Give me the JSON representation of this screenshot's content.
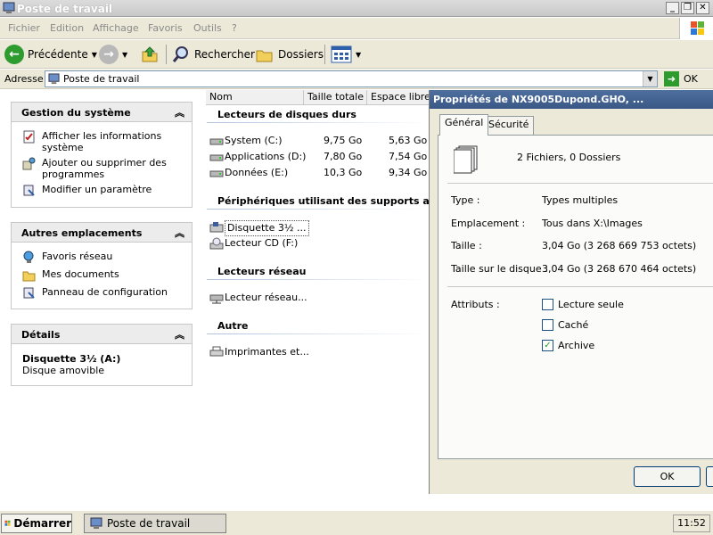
{
  "window": {
    "title": "Poste de travail",
    "controls": {
      "minimize": "_",
      "maximize": "❐",
      "close": "✕"
    }
  },
  "menu": {
    "items": [
      "Fichier",
      "Edition",
      "Affichage",
      "Favoris",
      "Outils",
      "?"
    ]
  },
  "toolbar": {
    "back_label": "Précédente",
    "search_label": "Rechercher",
    "folders_label": "Dossiers"
  },
  "address": {
    "label": "Adresse",
    "value": "Poste de travail",
    "go_label": "OK"
  },
  "tasks": {
    "system": {
      "title": "Gestion du système",
      "items": [
        {
          "line1": "Afficher les informations",
          "line2": "système"
        },
        {
          "line1": "Ajouter ou supprimer des",
          "line2": "programmes"
        },
        {
          "line1": "Modifier un paramètre",
          "line2": ""
        }
      ]
    },
    "other": {
      "title": "Autres emplacements",
      "items": [
        "Favoris réseau",
        "Mes documents",
        "Panneau de configuration"
      ]
    },
    "details": {
      "title": "Détails",
      "name": "Disquette 3½ (A:)",
      "type": "Disque amovible"
    },
    "collapse_glyph": "«"
  },
  "columns": [
    "Nom",
    "Taille totale",
    "Espace libre"
  ],
  "groups": {
    "hard_drives": {
      "title": "Lecteurs de disques durs",
      "rows": [
        {
          "name": "System (C:)",
          "total": "9,75 Go",
          "free": "5,63 Go"
        },
        {
          "name": "Applications (D:)",
          "total": "7,80 Go",
          "free": "7,54 Go"
        },
        {
          "name": "Données (E:)",
          "total": "10,3 Go",
          "free": "9,34 Go"
        }
      ]
    },
    "removable": {
      "title": "Périphériques utilisant des supports amovi",
      "rows": [
        {
          "name": "Disquette 3½ ..."
        },
        {
          "name": "Lecteur CD (F:)"
        }
      ]
    },
    "network": {
      "title": "Lecteurs réseau",
      "rows": [
        {
          "name": "Lecteur réseau..."
        }
      ]
    },
    "other": {
      "title": "Autre",
      "rows": [
        {
          "name": "Imprimantes et..."
        }
      ]
    }
  },
  "dialog": {
    "title": "Propriétés de NX9005Dupond.GHO, ...",
    "tabs": [
      "Général",
      "Sécurité"
    ],
    "summary": "2 Fichiers, 0 Dossiers",
    "fields": [
      {
        "label": "Type :",
        "value": "Types multiples"
      },
      {
        "label": "Emplacement :",
        "value": "Tous dans X:\\Images"
      },
      {
        "label": "Taille :",
        "value": "3,04 Go (3 268 669 753 octets)"
      },
      {
        "label": "Taille sur le disque :",
        "value": "3,04 Go (3 268 670 464 octets)"
      }
    ],
    "attributes_label": "Attributs :",
    "attributes": [
      {
        "label": "Lecture seule",
        "checked": false
      },
      {
        "label": "Caché",
        "checked": false
      },
      {
        "label": "Archive",
        "checked": true
      }
    ],
    "check_glyph": "✓",
    "ok_label": "OK"
  },
  "taskbar": {
    "start_label": "Démarrer",
    "task_label": "Poste de travail",
    "clock": "11:52"
  },
  "colors": {
    "dialog_title": "#3a5886",
    "group_line": "#b0c4de"
  }
}
